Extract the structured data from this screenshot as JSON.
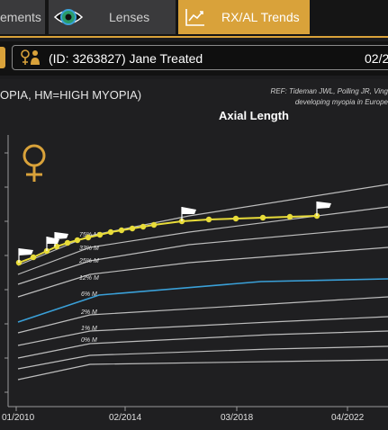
{
  "tabs": [
    {
      "label": "ements"
    },
    {
      "label": "Lenses"
    },
    {
      "label": "RX/AL Trends"
    }
  ],
  "patient": {
    "label": "(ID: 3263827) Jane Treated",
    "date": "02/2"
  },
  "legend_note": "OPIA, HM=HIGH MYOPIA)",
  "ref_note": {
    "line1": "REF: Tideman JWL, Polling JR, Ving",
    "line2": "developing myopia in Europe"
  },
  "colors": {
    "accent": "#d9a23a",
    "data_line": "#e8dc3a",
    "highlight_curve": "#3aa0d8",
    "percentile_curve": "#bdbdbd"
  },
  "chart_data": {
    "type": "line",
    "title": "Axial Length",
    "x_tick_labels": [
      "01/2010",
      "02/2014",
      "03/2018",
      "04/2022"
    ],
    "curve_labels": [
      "75% M",
      "33% M",
      "25% M",
      "12% M",
      "6% M",
      "2% M",
      "1% M",
      "0% M"
    ],
    "highlighted_curve": "6% M",
    "patient_series_points": 19,
    "flags": 5,
    "sex_icon": "female-symbol-icon"
  }
}
